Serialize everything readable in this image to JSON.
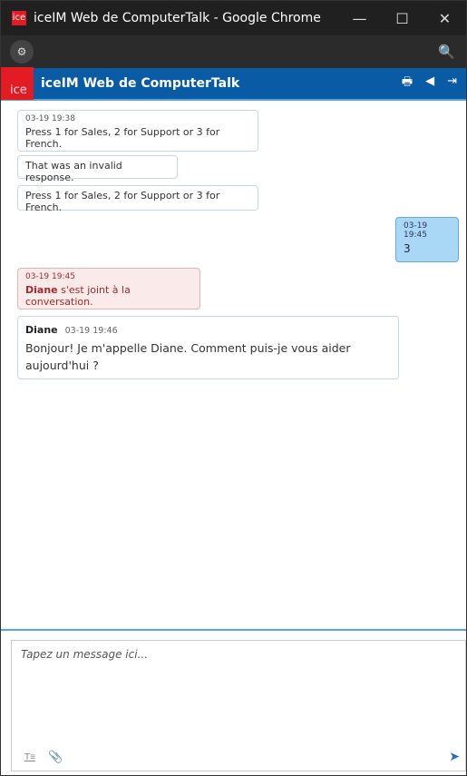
{
  "window": {
    "title": "iceIM Web de ComputerTalk - Google Chrome",
    "app_icon_text": "ice"
  },
  "window_controls": {
    "minimize": "—",
    "maximize": "☐",
    "close": "✕"
  },
  "toolbar": {
    "tune_icon": "⚙",
    "zoom_icon": "🔍"
  },
  "app": {
    "logo_text": "ice",
    "title": "iceIM Web de ComputerTalk"
  },
  "header_actions": {
    "print": "🖶",
    "sound": "◀",
    "exit": "⇥"
  },
  "messages": [
    {
      "time": "03-19 19:38",
      "text": "Press 1 for Sales, 2 for Support or 3 for French."
    },
    {
      "text": "That was an invalid response."
    },
    {
      "text": "Press 1 for Sales, 2 for Support or 3 for French."
    },
    {
      "time": "03-19 19:45",
      "text": "3"
    },
    {
      "time": "03-19 19:45",
      "name": "Diane",
      "text": "s'est joint à la conversation."
    },
    {
      "sender": "Diane",
      "time": "03-19 19:46",
      "text": "Bonjour! Je m'appelle Diane. Comment puis-je vous aider aujourd'hui ?"
    }
  ],
  "composer": {
    "placeholder": "Tapez un message ici...",
    "format_icon": "T≡",
    "attach_icon": "📎",
    "send_icon": "➤"
  },
  "colors": {
    "header": "#0a5ba6",
    "logo": "#e31b23",
    "user_bubble": "#a9d7f6",
    "system_bubble": "#fbeaea"
  }
}
